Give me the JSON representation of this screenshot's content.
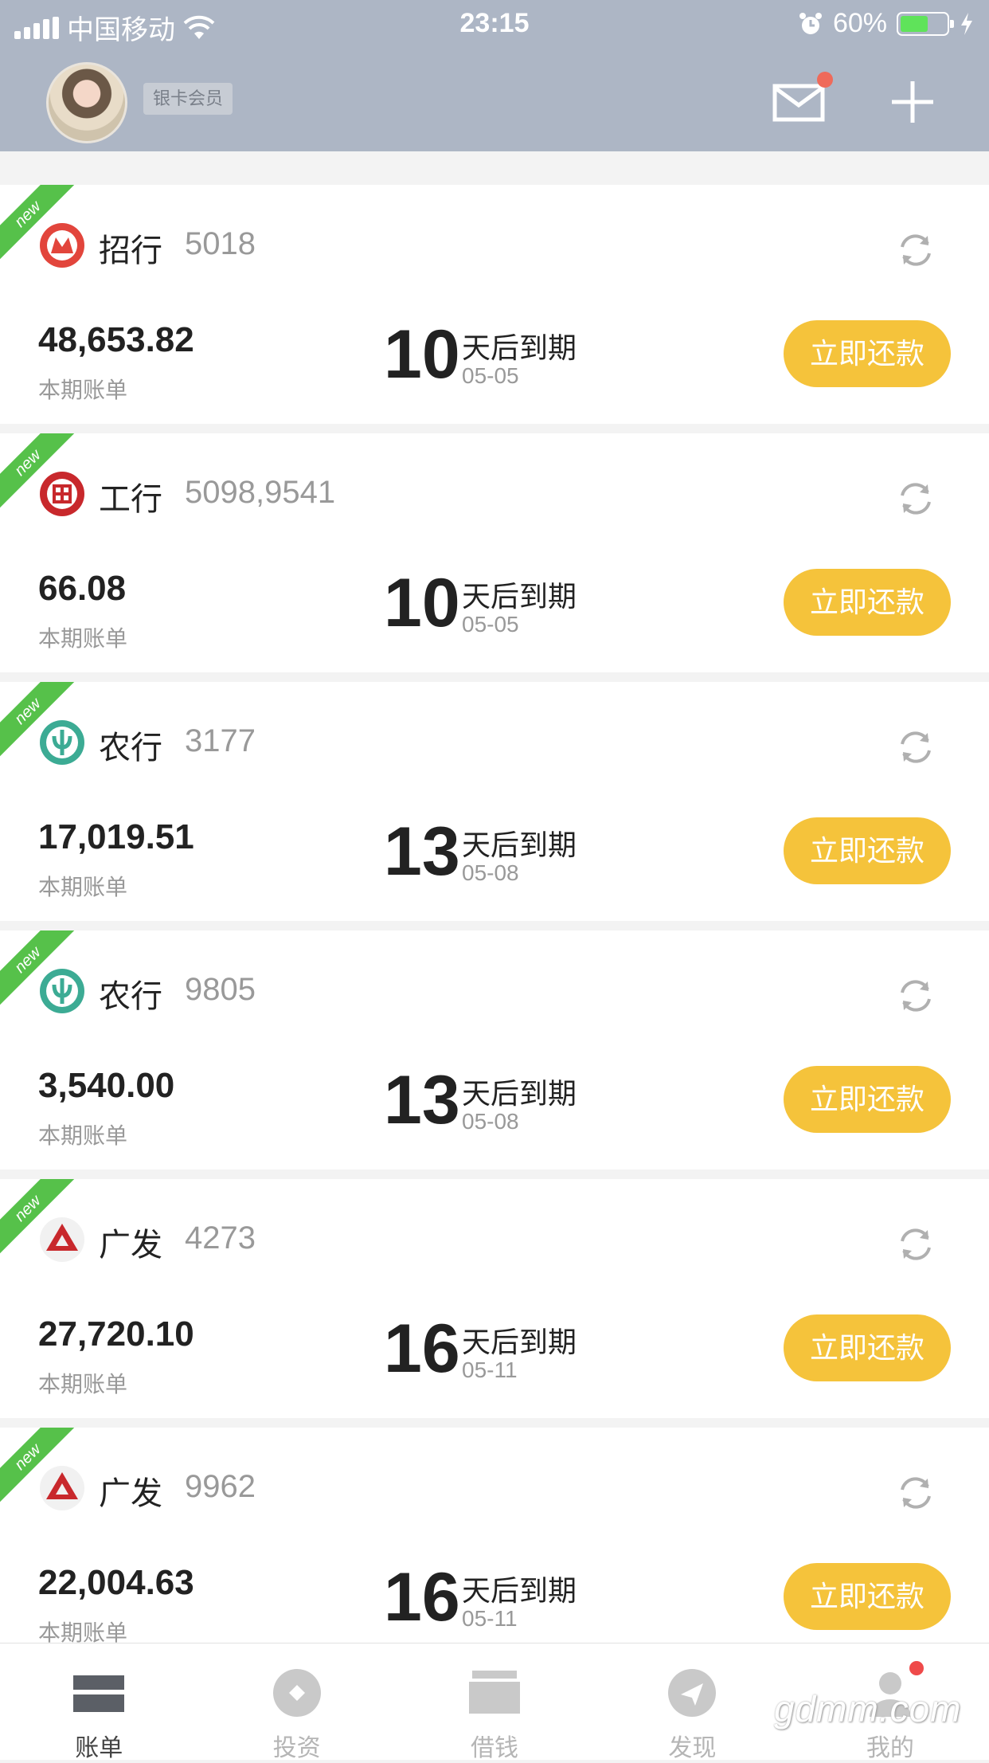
{
  "status_bar": {
    "carrier": "中国移动",
    "time": "23:15",
    "battery": "60%",
    "battery_level": 0.6
  },
  "header": {
    "member_badge": "银卡会员",
    "has_unread_mail": true
  },
  "ribbon_text": "new",
  "cards": [
    {
      "bank": "招行",
      "number": "5018",
      "amount": "48,653.82",
      "amount_label": "本期账单",
      "days": "10",
      "due_text": "天后到期",
      "due_date": "05-05",
      "button": "立即还款",
      "logo": "cmb-logo-icon"
    },
    {
      "bank": "工行",
      "number": "5098,9541",
      "amount": "66.08",
      "amount_label": "本期账单",
      "days": "10",
      "due_text": "天后到期",
      "due_date": "05-05",
      "button": "立即还款",
      "logo": "icbc-logo-icon"
    },
    {
      "bank": "农行",
      "number": "3177",
      "amount": "17,019.51",
      "amount_label": "本期账单",
      "days": "13",
      "due_text": "天后到期",
      "due_date": "05-08",
      "button": "立即还款",
      "logo": "abc-logo-icon"
    },
    {
      "bank": "农行",
      "number": "9805",
      "amount": "3,540.00",
      "amount_label": "本期账单",
      "days": "13",
      "due_text": "天后到期",
      "due_date": "05-08",
      "button": "立即还款",
      "logo": "abc-logo-icon"
    },
    {
      "bank": "广发",
      "number": "4273",
      "amount": "27,720.10",
      "amount_label": "本期账单",
      "days": "16",
      "due_text": "天后到期",
      "due_date": "05-11",
      "button": "立即还款",
      "logo": "cgb-logo-icon"
    },
    {
      "bank": "广发",
      "number": "9962",
      "amount": "22,004.63",
      "amount_label": "本期账单",
      "days": "16",
      "due_text": "天后到期",
      "due_date": "05-11",
      "button": "立即还款",
      "logo": "cgb-logo-icon"
    }
  ],
  "tabs": [
    {
      "label": "账单",
      "active": true
    },
    {
      "label": "投资",
      "active": false
    },
    {
      "label": "借钱",
      "active": false
    },
    {
      "label": "发现",
      "active": false
    },
    {
      "label": "我的",
      "active": false
    }
  ],
  "watermark": "gdmm.com",
  "colors": {
    "header_bg": "#adb6c5",
    "pay_button": "#f5c33b",
    "ribbon": "#56c14a",
    "cmb_red": "#e2453c",
    "icbc_red": "#c8282c",
    "abc_teal": "#3cab94",
    "cgb_red": "#c8282c"
  }
}
